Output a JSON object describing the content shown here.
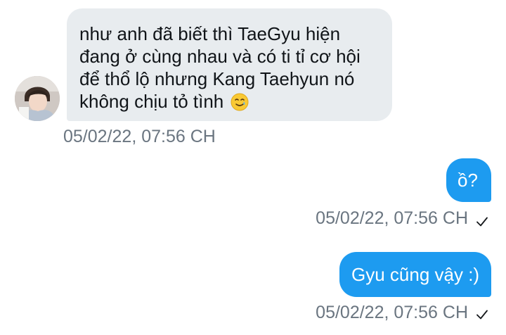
{
  "conversation": {
    "messages": [
      {
        "direction": "received",
        "lines": [
          "như anh đã biết thì TaeGyu hiện",
          "đang ở cùng nhau và có ti tỉ cơ hội",
          "để thổ lộ nhưng Kang Taehyun nó",
          "không chịu tỏ tình"
        ],
        "emoji": "smiling-face-with-tear-emoji",
        "timestamp": "05/02/22, 07:56 CH"
      },
      {
        "direction": "sent",
        "text": "ồ?",
        "timestamp": "05/02/22, 07:56 CH",
        "status_icon": "checkmark-icon"
      },
      {
        "direction": "sent",
        "text": "Gyu cũng vậy :)",
        "timestamp": "05/02/22, 07:56 CH",
        "status_icon": "checkmark-icon"
      }
    ]
  },
  "colors": {
    "received_bubble": "#e8ecef",
    "sent_bubble": "#1d9bf0",
    "timestamp_text": "#6a7580"
  }
}
